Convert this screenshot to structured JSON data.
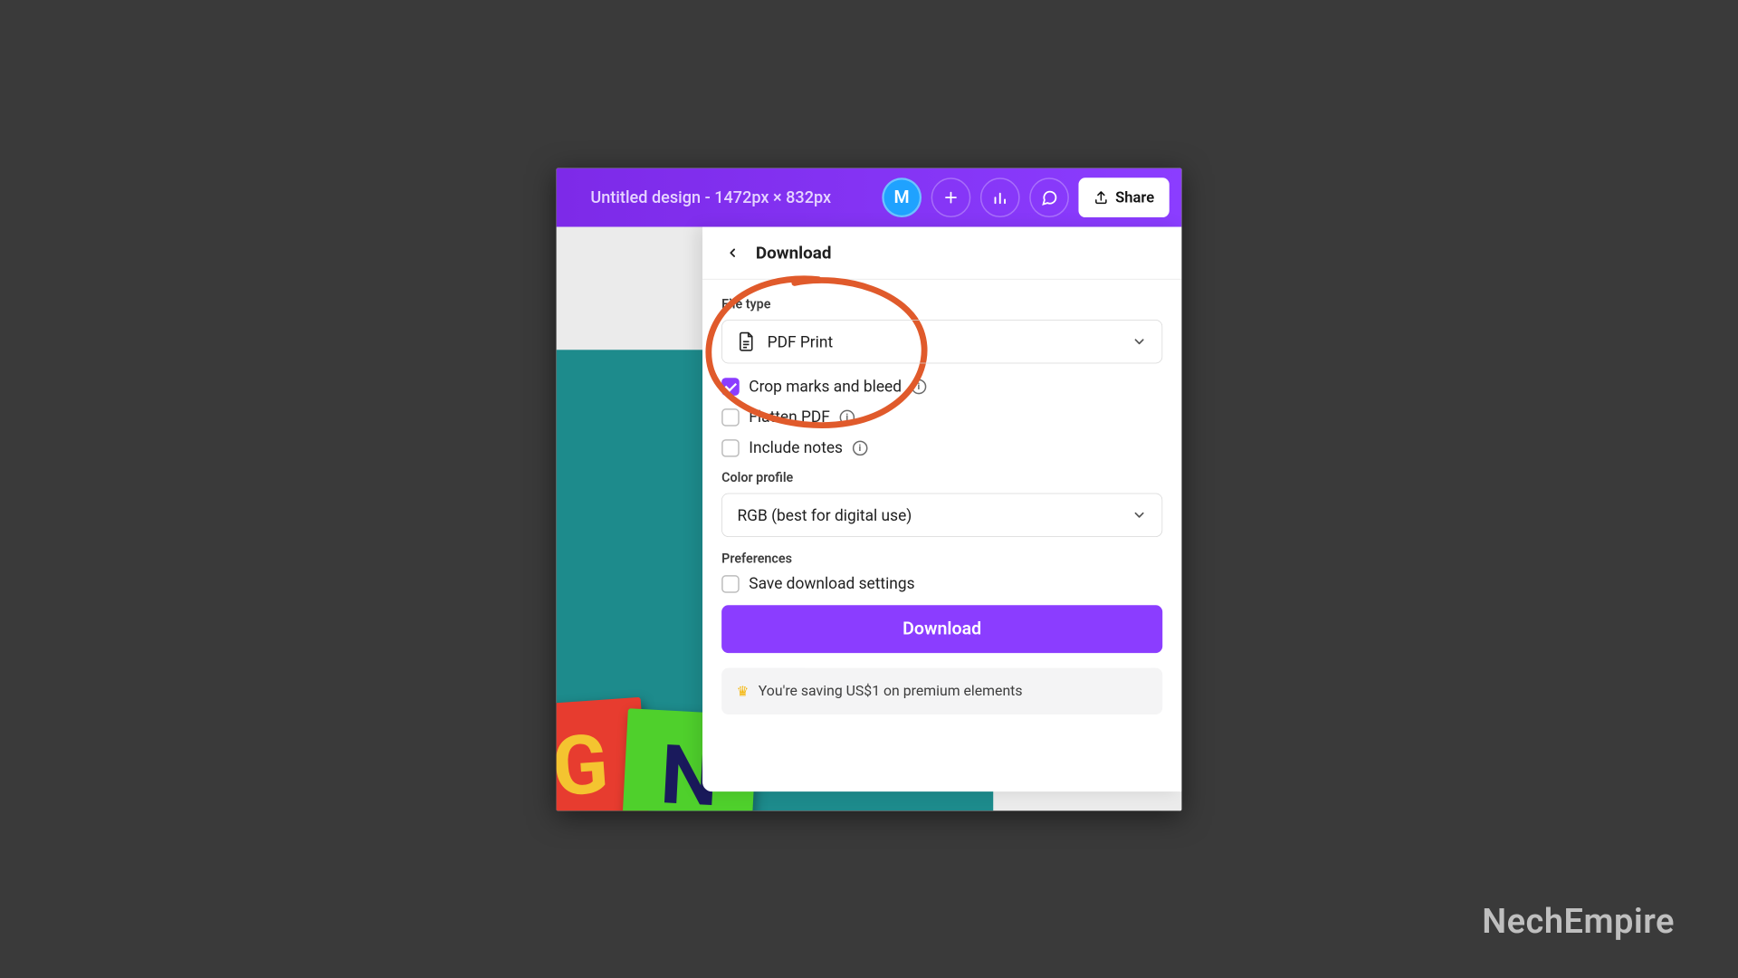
{
  "topbar": {
    "title": "Untitled design - 1472px × 832px",
    "avatar_initial": "M",
    "share_label": "Share"
  },
  "panel": {
    "title": "Download",
    "file_type_label": "File type",
    "file_type_value": "PDF Print",
    "options": {
      "crop_marks": {
        "label": "Crop marks and bleed",
        "checked": true
      },
      "flatten": {
        "label": "Flatten PDF",
        "checked": false
      },
      "notes": {
        "label": "Include notes",
        "checked": false
      }
    },
    "color_profile_label": "Color profile",
    "color_profile_value": "RGB (best for digital use)",
    "preferences_label": "Preferences",
    "save_settings": {
      "label": "Save download settings",
      "checked": false
    },
    "download_button": "Download",
    "savings_text": "You're saving US$1 on premium elements"
  },
  "watermark": "NechEmpire",
  "colors": {
    "accent": "#8b3dff",
    "annotation": "#e05a2b"
  }
}
